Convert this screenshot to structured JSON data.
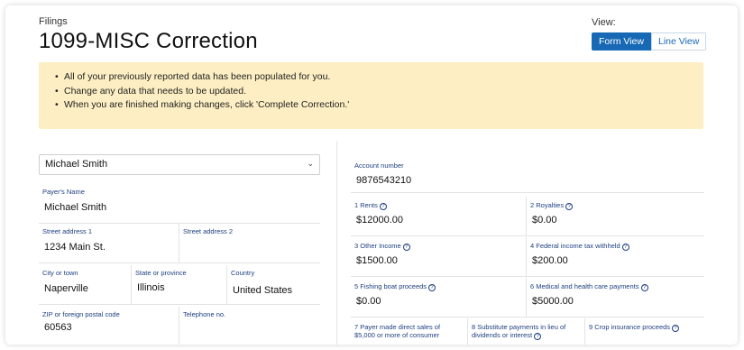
{
  "header": {
    "breadcrumb": "Filings",
    "title": "1099-MISC Correction",
    "view_label": "View:",
    "form_view": "Form View",
    "line_view": "Line View"
  },
  "notice": {
    "items": [
      "All of your previously reported data has been populated for you.",
      "Change any data that needs to be updated.",
      "When you are finished making changes, click 'Complete Correction.'"
    ]
  },
  "payer": {
    "selected": "Michael Smith",
    "name_label": "Payer's Name",
    "name": "Michael Smith",
    "street1_label": "Street address 1",
    "street1": "1234 Main St.",
    "street2_label": "Street address 2",
    "street2": "",
    "city_label": "City or town",
    "city": "Naperville",
    "state_label": "State or province",
    "state": "Illinois",
    "country_label": "Country",
    "country": "United States",
    "zip_label": "ZIP or foreign postal code",
    "zip": "60563",
    "phone_label": "Telephone no.",
    "phone": ""
  },
  "form": {
    "account_label": "Account number",
    "account": "9876543210",
    "box1_label": "1 Rents",
    "box1": "$12000.00",
    "box2_label": "2 Royalties",
    "box2": "$0.00",
    "box3_label": "3 Other Income",
    "box3": "$1500.00",
    "box4_label": "4 Federal income tax withheld",
    "box4": "$200.00",
    "box5_label": "5 Fishing boat proceeds",
    "box5": "$0.00",
    "box6_label": "6 Medical and health care payments",
    "box6": "$5000.00",
    "box7_label_1": "7 Payer made direct sales of",
    "box7_label_2": "$5,000 or more of consumer",
    "box8_label_1": "8 Substitute payments in lieu of",
    "box8_label_2": "dividends or interest",
    "box9_label": "9 Crop insurance proceeds",
    "info_glyph": "?"
  }
}
